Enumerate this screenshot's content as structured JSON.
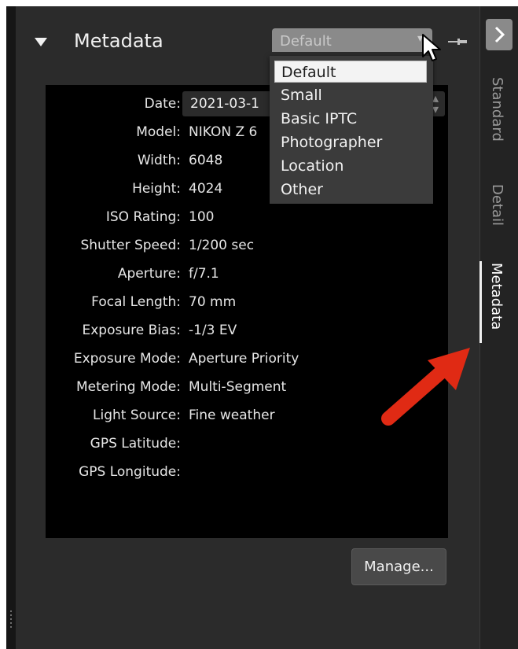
{
  "panel": {
    "title": "Metadata",
    "preset_selected": "Default"
  },
  "preset_dropdown": {
    "options": [
      "Default",
      "Small",
      "Basic IPTC",
      "Photographer",
      "Location",
      "Other"
    ],
    "selected_index": 0
  },
  "metadata": {
    "date_label": "Date:",
    "date_value": "2021-03-1",
    "rows": [
      {
        "label": "Model:",
        "value": "NIKON Z 6"
      },
      {
        "label": "Width:",
        "value": "6048"
      },
      {
        "label": "Height:",
        "value": "4024"
      },
      {
        "label": "ISO Rating:",
        "value": "100"
      },
      {
        "label": "Shutter Speed:",
        "value": "1/200 sec"
      },
      {
        "label": "Aperture:",
        "value": "f/7.1"
      },
      {
        "label": "Focal Length:",
        "value": "70 mm"
      },
      {
        "label": "Exposure Bias:",
        "value": "-1/3 EV"
      },
      {
        "label": "Exposure Mode:",
        "value": "Aperture Priority"
      },
      {
        "label": "Metering Mode:",
        "value": "Multi-Segment"
      },
      {
        "label": "Light Source:",
        "value": "Fine weather"
      },
      {
        "label": "GPS Latitude:",
        "value": ""
      },
      {
        "label": "GPS Longitude:",
        "value": ""
      }
    ]
  },
  "buttons": {
    "manage": "Manage..."
  },
  "side_tabs": [
    {
      "label": "Standard",
      "active": false
    },
    {
      "label": "Detail",
      "active": false
    },
    {
      "label": "Metadata",
      "active": true
    }
  ],
  "colors": {
    "panel_bg": "#2b2b2b",
    "metadata_bg": "#000000",
    "annotation_arrow": "#e02a14"
  },
  "icons": {
    "collapse": "triangle-down-icon",
    "pin": "pin-icon",
    "expand": "chevron-right-icon",
    "cursor": "mouse-pointer-icon"
  }
}
